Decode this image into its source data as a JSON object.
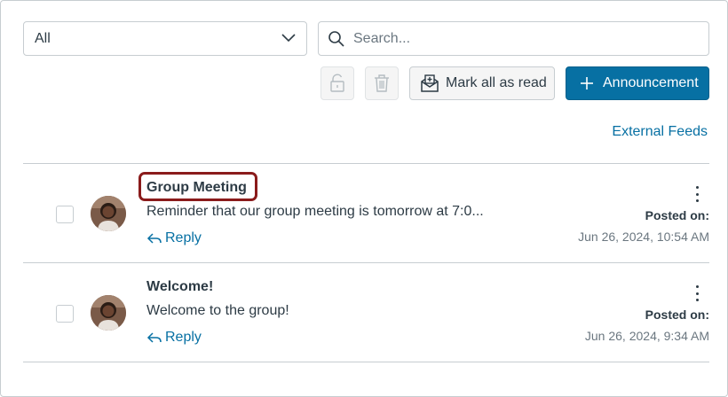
{
  "filter": {
    "selected": "All"
  },
  "search": {
    "placeholder": "Search..."
  },
  "toolbar": {
    "mark_all_read_label": "Mark all as read",
    "announcement_label": "Announcement"
  },
  "external_feeds_label": "External Feeds",
  "announcements": [
    {
      "title": "Group Meeting",
      "message": "Reminder that our group meeting is tomorrow at 7:0...",
      "reply_label": "Reply",
      "posted_label": "Posted on:",
      "posted_date": "Jun 26, 2024, 10:54 AM"
    },
    {
      "title": "Welcome!",
      "message": "Welcome to the group!",
      "reply_label": "Reply",
      "posted_label": "Posted on:",
      "posted_date": "Jun 26, 2024, 9:34 AM"
    }
  ],
  "colors": {
    "accent": "#0770a3",
    "highlight": "#8a1b1b",
    "text": "#2d3b45",
    "muted": "#6b7780"
  }
}
